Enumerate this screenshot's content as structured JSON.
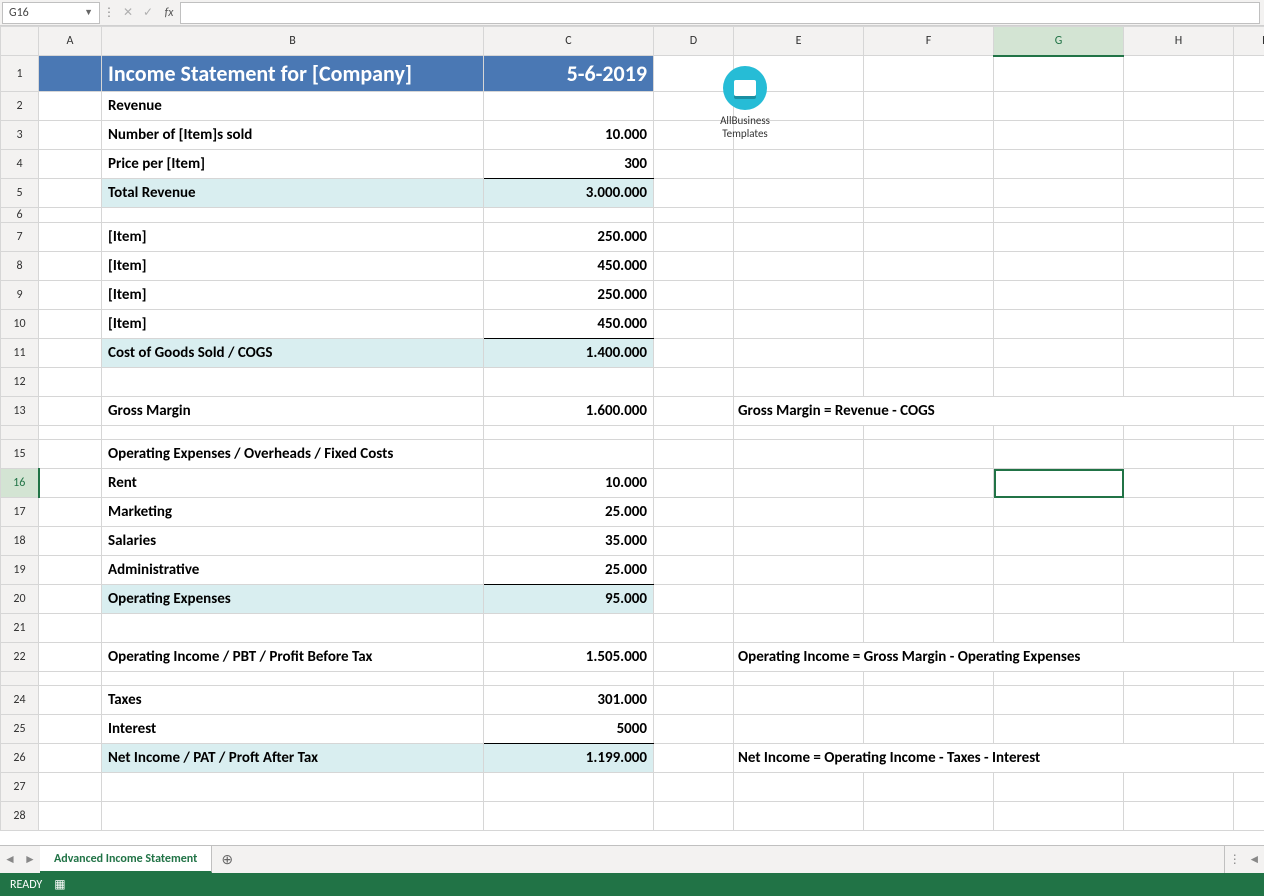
{
  "formula_bar": {
    "name_box": "G16",
    "fx_label": "fx",
    "value": ""
  },
  "columns": [
    "A",
    "B",
    "C",
    "D",
    "E",
    "F",
    "G",
    "H",
    "I"
  ],
  "selected_column": "G",
  "selected_row": "16",
  "title": {
    "label": "Income Statement for [Company]",
    "date": "5-6-2019"
  },
  "logo_caption": "AllBusiness\nTemplates",
  "rows": {
    "r2": {
      "b": "Revenue"
    },
    "r3": {
      "b": "Number of [Item]s sold",
      "c": "10.000"
    },
    "r4": {
      "b": "Price per [Item]",
      "c": "300"
    },
    "r5": {
      "b": "Total Revenue",
      "c": "3.000.000"
    },
    "r7": {
      "b": "[Item]",
      "c": "250.000"
    },
    "r8": {
      "b": "[Item]",
      "c": "450.000"
    },
    "r9": {
      "b": "[Item]",
      "c": "250.000"
    },
    "r10": {
      "b": "[Item]",
      "c": "450.000"
    },
    "r11": {
      "b": "Cost of Goods Sold / COGS",
      "c": "1.400.000"
    },
    "r13": {
      "b": "Gross Margin",
      "c": "1.600.000",
      "note": "Gross Margin = Revenue - COGS"
    },
    "r15": {
      "b": "Operating Expenses / Overheads / Fixed Costs"
    },
    "r16": {
      "b": "Rent",
      "c": "10.000"
    },
    "r17": {
      "b": "Marketing",
      "c": "25.000"
    },
    "r18": {
      "b": "Salaries",
      "c": "35.000"
    },
    "r19": {
      "b": "Administrative",
      "c": "25.000"
    },
    "r20": {
      "b": "Operating Expenses",
      "c": "95.000"
    },
    "r22": {
      "b": "Operating Income / PBT / Profit Before Tax",
      "c": "1.505.000",
      "note": "Operating Income = Gross Margin - Operating Expenses"
    },
    "r24": {
      "b": "Taxes",
      "c": "301.000"
    },
    "r25": {
      "b": "Interest",
      "c": "5000"
    },
    "r26": {
      "b": "Net Income / PAT / Proft After Tax",
      "c": "1.199.000",
      "note": "Net Income = Operating Income - Taxes - Interest"
    }
  },
  "sheet_tab": "Advanced Income Statement",
  "status": "READY"
}
